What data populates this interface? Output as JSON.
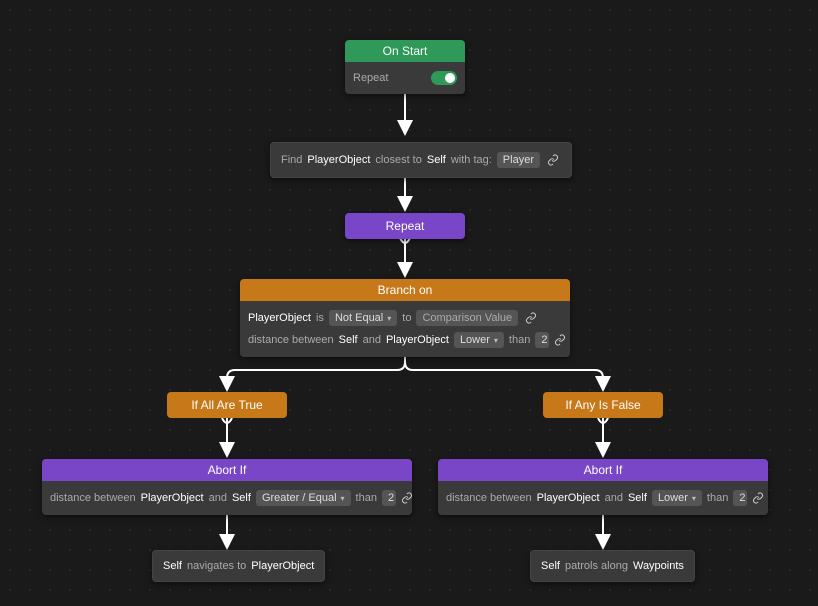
{
  "onStart": {
    "title": "On Start",
    "repeatLabel": "Repeat"
  },
  "find": {
    "pre": "Find",
    "entity": "PlayerObject",
    "closest": "closest to",
    "self": "Self",
    "withTag": "with tag:",
    "tagValue": "Player"
  },
  "repeat": {
    "title": "Repeat"
  },
  "branch": {
    "title": "Branch on",
    "row1": {
      "entity": "PlayerObject",
      "is": "is",
      "op": "Not Equal",
      "to": "to",
      "comparison": "Comparison Value"
    },
    "row2": {
      "pre": "distance between",
      "self": "Self",
      "and": "and",
      "entity": "PlayerObject",
      "op": "Lower",
      "than": "than",
      "val": "2"
    }
  },
  "ifTrue": {
    "title": "If All Are True"
  },
  "ifFalse": {
    "title": "If Any Is False"
  },
  "abortLeft": {
    "title": "Abort If",
    "pre": "distance between",
    "entity": "PlayerObject",
    "and": "and",
    "self": "Self",
    "op": "Greater / Equal",
    "than": "than",
    "val": "2"
  },
  "abortRight": {
    "title": "Abort If",
    "pre": "distance between",
    "entity": "PlayerObject",
    "and": "and",
    "self": "Self",
    "op": "Lower",
    "than": "than",
    "val": "2"
  },
  "navLeft": {
    "self": "Self",
    "txt": "navigates to",
    "target": "PlayerObject"
  },
  "navRight": {
    "self": "Self",
    "txt": "patrols along",
    "target": "Waypoints"
  }
}
